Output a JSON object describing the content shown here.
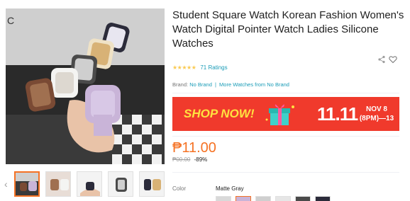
{
  "product": {
    "title": "Student Square Watch Korean Fashion Women's Watch Digital Pointer Watch Ladies Silicone Watches",
    "stars": "★★★★★",
    "ratings": "71 Ratings",
    "brand_label": "Brand:",
    "brand_value": "No Brand",
    "brand_separator": "|",
    "more_from": "More Watches from No Brand",
    "price": "₱11.00",
    "original_price": "₱00.00",
    "discount": "-89%",
    "color_label": "Color",
    "color_value": "Matte Gray"
  },
  "banner": {
    "shop_now": "SHOP NOW!",
    "event": "11.11",
    "date_line1": "NOV 8",
    "date_line2": "(8PM)—13"
  },
  "gallery": {
    "prev_arrow": "‹",
    "next_arrow": "›"
  },
  "colors": {
    "accent": "#f57224",
    "link": "#1a9cb7",
    "banner_bg": "#f03a2c",
    "banner_text": "#ffe240",
    "star": "#faca51"
  }
}
